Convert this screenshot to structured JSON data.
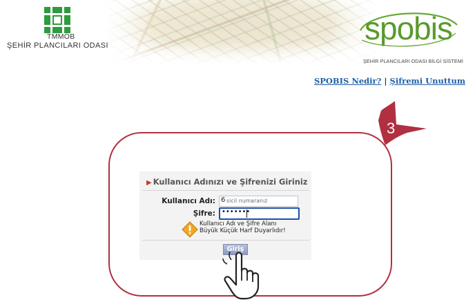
{
  "header": {
    "org_short": "TMMOB",
    "org_full": "ŞEHİR PLANCILARI ODASI",
    "app_logo": "spobis",
    "app_subtitle": "ŞEHİR PLANCILARI ODASI BİLGİ SİSTEMİ",
    "links": [
      {
        "label": "SPOBIS Nedir?"
      },
      {
        "label": "Şifremi Unuttum"
      }
    ],
    "link_separator": "|"
  },
  "annotation": {
    "step_number": "3",
    "color": "#b03041"
  },
  "login": {
    "title": "Kullanıcı Adınızı ve Şifrenizi Giriniz",
    "username_label": "Kullanıcı Adı:",
    "username_value": "6",
    "username_placeholder": "sicil numaranız",
    "password_label": "Şifre:",
    "password_value": "•••••••",
    "warning_line1": "Kullanıcı Adı ve Şifre Alanı",
    "warning_line2": "Büyük Küçük Harf Duyarlıdır!",
    "submit_label": "Giriş"
  },
  "icons": [
    "tmmob-logo-icon",
    "warning-icon",
    "pointer-hand-icon",
    "step-arrow-icon"
  ],
  "colors": {
    "brand_green": "#5a9a2d",
    "link_blue": "#1f5fa6",
    "accent_red": "#b03041",
    "input_focus": "#1e4fa8"
  }
}
